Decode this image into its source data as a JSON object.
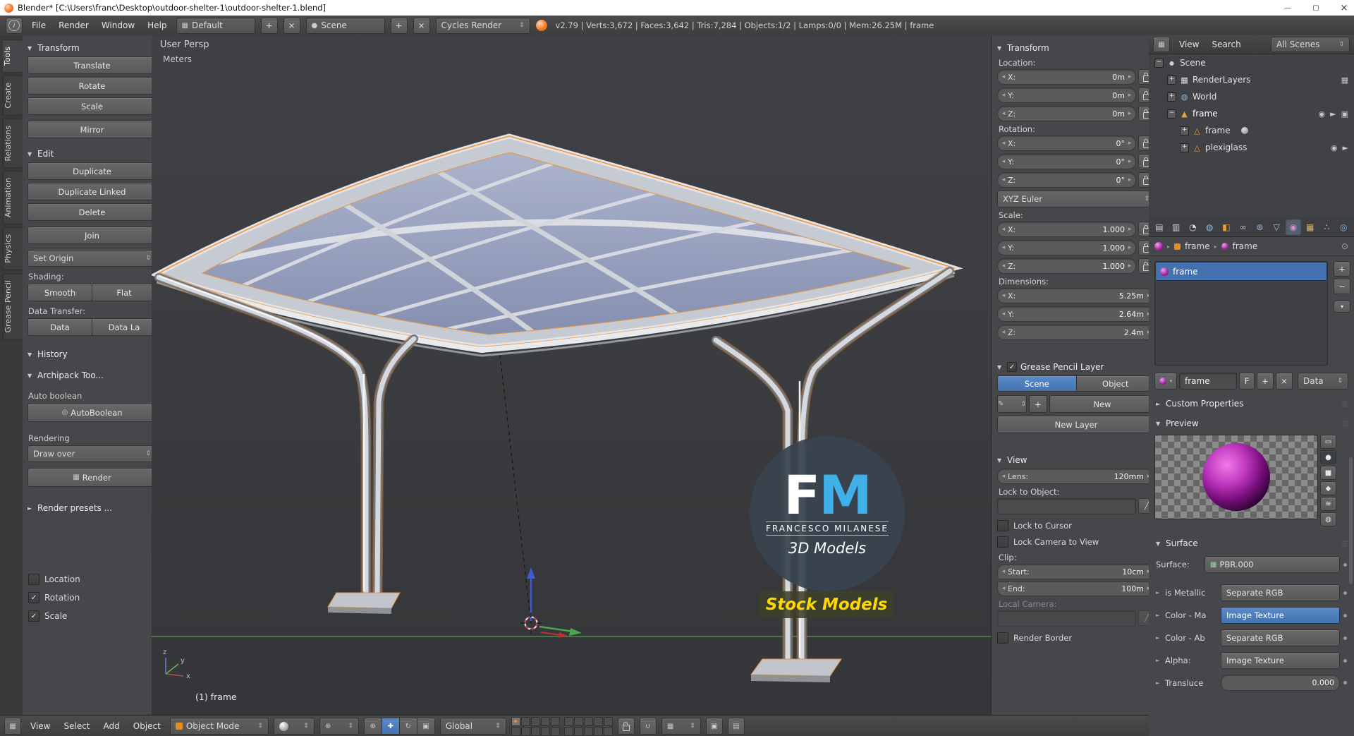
{
  "colors": {
    "blender_orange": "#f5792a",
    "accent_blue": "#4a7ab5",
    "selection_orange": "#e8943c",
    "watermark_blue": "#3fb0e8",
    "watermark_yellow": "#ffd800"
  },
  "icons": {
    "minimize": "—",
    "maximize": "▢",
    "close": "×",
    "tri_down": "▼",
    "tri_right": "►",
    "dots": "⣿⣿",
    "left": "◂",
    "right": "▸",
    "updown": "⇕",
    "chev_down": "▾",
    "plus": "+",
    "minus": "−",
    "x": "×",
    "check": "✓",
    "exp_open": "−",
    "exp_closed": "+",
    "eye": "◉",
    "pointer": "►",
    "camera": "▣",
    "scene": "●",
    "world": "◍",
    "image": "▦",
    "mesh_obj": "▲",
    "mesh_data": "△",
    "pencil": "✎",
    "dropper": "╱",
    "magnet": "∪",
    "rotate": "↻",
    "translate": "✚",
    "scale_icon": "▣",
    "axes": "⊕",
    "info": "i",
    "screen": "▦",
    "grid": "▦",
    "node": "▦",
    "boolean": "◎",
    "render_img": "▦",
    "pin": "⊙",
    "tab_render": "▤",
    "tab_layers": "▥",
    "tab_scene": "◔",
    "tab_world": "◍",
    "tab_object": "◧",
    "tab_constraints": "∞",
    "tab_modifiers": "⊛",
    "tab_data": "▽",
    "tab_material": "◉",
    "tab_texture": "▦",
    "tab_particles": "∴",
    "tab_physics": "◎",
    "pv_flat": "▭",
    "pv_sphere": "●",
    "pv_cube": "■",
    "pv_monkey": "◆",
    "pv_hair": "≋",
    "pv_world": "◍"
  },
  "titlebar": {
    "title": "Blender* [C:\\Users\\franc\\Desktop\\outdoor-shelter-1\\outdoor-shelter-1.blend]"
  },
  "infobar": {
    "menus": [
      "File",
      "Render",
      "Window",
      "Help"
    ],
    "layout": "Default",
    "scene": "Scene",
    "engine": "Cycles Render",
    "stats": "v2.79 | Verts:3,672 | Faces:3,642 | Tris:7,284 | Objects:1/2 | Lamps:0/0 | Mem:26.25M | frame"
  },
  "tabs": [
    "Tools",
    "Create",
    "Relations",
    "Animation",
    "Physics",
    "Grease Pencil"
  ],
  "shelf": {
    "transform_title": "Transform",
    "translate": "Translate",
    "rotate": "Rotate",
    "scale": "Scale",
    "mirror": "Mirror",
    "edit_title": "Edit",
    "duplicate": "Duplicate",
    "duplicate_linked": "Duplicate Linked",
    "delete_label": "Delete",
    "join": "Join",
    "set_origin": "Set Origin",
    "shading_label": "Shading:",
    "smooth": "Smooth",
    "flat": "Flat",
    "data_transfer_label": "Data Transfer:",
    "data": "Data",
    "data_layout": "Data La",
    "history_title": "History",
    "archipack_title": "Archipack Too...",
    "auto_boolean": "Auto boolean",
    "autoboolean": "AutoBoolean",
    "rendering_label": "Rendering",
    "draw_over": "Draw over",
    "render": "Render",
    "render_presets": "Render presets ...",
    "opt_location": "Location",
    "opt_rotation": "Rotation",
    "opt_scale": "Scale"
  },
  "viewport": {
    "persp": "User Persp",
    "units": "Meters",
    "active": "(1) frame",
    "wm_f": "F",
    "wm_m": "M",
    "wm_name": "FRANCESCO MILANESE",
    "wm_models": "3D Models",
    "wm_stock": "Stock Models"
  },
  "npanel": {
    "transform_title": "Transform",
    "location_label": "Location:",
    "loc": [
      {
        "a": "X:",
        "v": "0m"
      },
      {
        "a": "Y:",
        "v": "0m"
      },
      {
        "a": "Z:",
        "v": "0m"
      }
    ],
    "rotation_label": "Rotation:",
    "rot": [
      {
        "a": "X:",
        "v": "0°"
      },
      {
        "a": "Y:",
        "v": "0°"
      },
      {
        "a": "Z:",
        "v": "0°"
      }
    ],
    "euler": "XYZ Euler",
    "scale_label": "Scale:",
    "scl": [
      {
        "a": "X:",
        "v": "1.000"
      },
      {
        "a": "Y:",
        "v": "1.000"
      },
      {
        "a": "Z:",
        "v": "1.000"
      }
    ],
    "dimensions_label": "Dimensions:",
    "dim": [
      {
        "a": "X:",
        "v": "5.25m"
      },
      {
        "a": "Y:",
        "v": "2.64m"
      },
      {
        "a": "Z:",
        "v": "2.4m"
      }
    ],
    "gp_title": "Grease Pencil Layer",
    "gp_scene": "Scene",
    "gp_object": "Object",
    "gp_new": "New",
    "gp_new_layer": "New Layer",
    "view_title": "View",
    "lens_label": "Lens:",
    "lens_value": "120mm",
    "lock_to_object": "Lock to Object:",
    "lock_to_cursor": "Lock to Cursor",
    "lock_camera": "Lock Camera to View",
    "clip_label": "Clip:",
    "clip_start_label": "Start:",
    "clip_start_value": "10cm",
    "clip_end_label": "End:",
    "clip_end_value": "100m",
    "local_camera": "Local Camera:",
    "render_border": "Render Border"
  },
  "vheader": {
    "menus": [
      "View",
      "Select",
      "Add",
      "Object"
    ],
    "mode": "Object Mode",
    "orientation": "Global"
  },
  "outliner": {
    "view": "View",
    "search": "Search",
    "all_scenes": "All Scenes",
    "rows": [
      "Scene",
      "RenderLayers",
      "World",
      "frame",
      "frame",
      "plexiglass"
    ]
  },
  "props": {
    "bc_object": "frame",
    "bc_data": "frame",
    "slot_name": "frame",
    "name_value": "frame",
    "fake": "F",
    "data_label": "Data",
    "custom_title": "Custom Properties",
    "preview_title": "Preview",
    "surface_title": "Surface",
    "surface_label": "Surface:",
    "surface_value": "PBR.000",
    "rows": [
      {
        "l": "is Metallic",
        "v": "Separate RGB"
      },
      {
        "l": "Color - Ma",
        "v": "Image Texture"
      },
      {
        "l": "Color - Ab",
        "v": "Separate RGB"
      },
      {
        "l": "Alpha:",
        "v": "Image Texture"
      },
      {
        "l": "Transluce",
        "v": "0.000"
      }
    ]
  }
}
